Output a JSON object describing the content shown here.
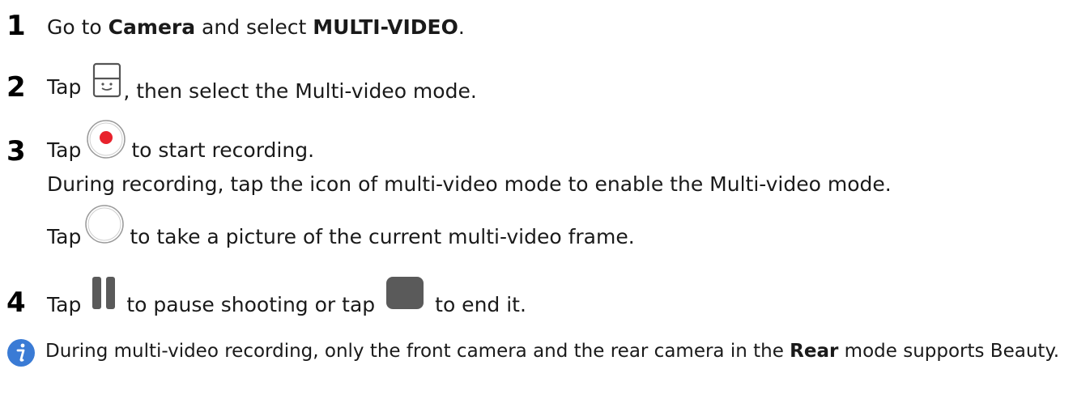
{
  "steps": [
    {
      "number": "1",
      "parts": [
        "Go to ",
        "Camera",
        " and select ",
        "MULTI-VIDEO",
        "."
      ]
    },
    {
      "number": "2",
      "before": "Tap",
      "after": ", then select the Multi-video mode.",
      "icon": "camera-mode-switch-icon"
    },
    {
      "number": "3",
      "before": "Tap",
      "after": "to start recording.",
      "icon": "record-button-icon",
      "line2": "During recording, tap the icon of multi-video mode to enable the Multi-video mode.",
      "line3_before": "Tap",
      "line3_after": "to take a picture of the current multi-video frame.",
      "line3_icon": "shutter-button-icon"
    },
    {
      "number": "4",
      "before": "Tap",
      "middle": "to pause shooting or tap",
      "after": "to end it.",
      "icons": [
        "pause-icon",
        "stop-icon"
      ]
    }
  ],
  "note": {
    "icon": "info-icon",
    "text_before": "During multi-video recording, only the front camera and the rear camera in the ",
    "bold": "Rear",
    "text_after": " mode supports Beauty."
  },
  "colors": {
    "record_red": "#e8222c",
    "info_blue": "#3a7bd5",
    "icon_gray": "#5a5a5a"
  }
}
